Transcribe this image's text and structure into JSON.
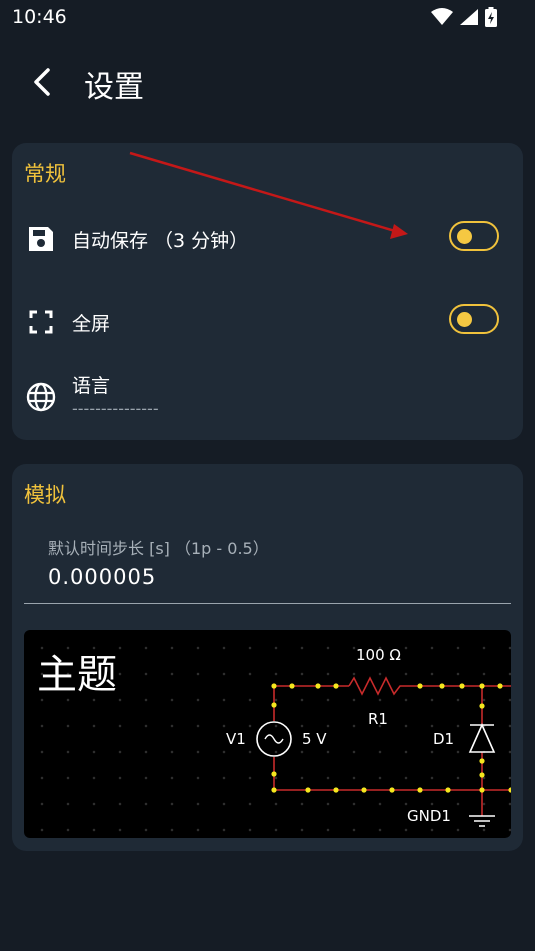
{
  "status_bar": {
    "time": "10:46"
  },
  "app_bar": {
    "title": "设置"
  },
  "general": {
    "title": "常规",
    "autosave": {
      "label": "自动保存 （3 分钟）",
      "enabled": false
    },
    "fullscreen": {
      "label": "全屏",
      "enabled": false
    },
    "language": {
      "label": "语言",
      "value": "---------------"
    }
  },
  "simulation": {
    "title": "模拟",
    "timestep": {
      "label": "默认时间步长 [s] （1p - 0.5）",
      "value": "0.000005"
    },
    "theme": {
      "title": "主题",
      "circuit_labels": {
        "resistor_value": "100 Ω",
        "resistor_name": "R1",
        "source_name": "V1",
        "source_value": "5 V",
        "diode_name": "D1",
        "ground_name": "GND1"
      }
    }
  },
  "colors": {
    "accent": "#f0c23c",
    "card": "#1f2a36",
    "background": "#151c25",
    "wire": "#c72b2b",
    "node": "#f5e71e",
    "annotation_arrow": "#c41818"
  }
}
